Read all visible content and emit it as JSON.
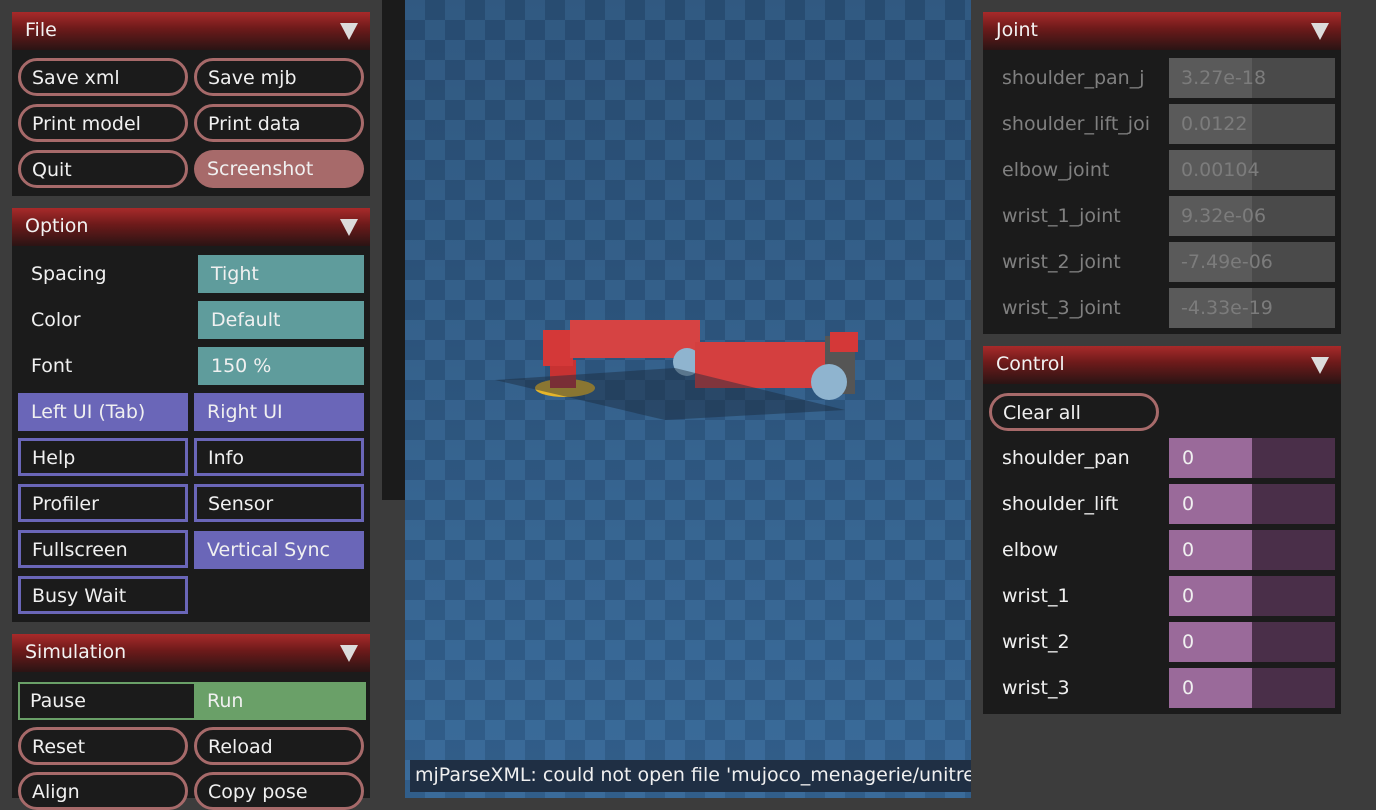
{
  "file": {
    "title": "File",
    "buttons": [
      "Save xml",
      "Save mjb",
      "Print model",
      "Print data",
      "Quit",
      "Screenshot"
    ]
  },
  "option": {
    "title": "Option",
    "rows": [
      {
        "label": "Spacing",
        "value": "Tight"
      },
      {
        "label": "Color",
        "value": "Default"
      },
      {
        "label": "Font",
        "value": "150 %"
      }
    ],
    "buttons": [
      "Left UI (Tab)",
      "Right UI",
      "Help",
      "Info",
      "Profiler",
      "Sensor",
      "Fullscreen",
      "Vertical Sync",
      "Busy Wait"
    ]
  },
  "simulation": {
    "title": "Simulation",
    "mode": [
      "Pause",
      "Run"
    ],
    "buttons": [
      "Reset",
      "Reload",
      "Align",
      "Copy pose"
    ]
  },
  "joint": {
    "title": "Joint",
    "items": [
      {
        "name": "shoulder_pan_j",
        "value": "3.27e-18"
      },
      {
        "name": "shoulder_lift_joi",
        "value": "0.0122"
      },
      {
        "name": "elbow_joint",
        "value": "0.00104"
      },
      {
        "name": "wrist_1_joint",
        "value": "9.32e-06"
      },
      {
        "name": "wrist_2_joint",
        "value": "-7.49e-06"
      },
      {
        "name": "wrist_3_joint",
        "value": "-4.33e-19"
      }
    ]
  },
  "control": {
    "title": "Control",
    "clear_label": "Clear all",
    "items": [
      {
        "name": "shoulder_pan",
        "value": "0"
      },
      {
        "name": "shoulder_lift",
        "value": "0"
      },
      {
        "name": "elbow",
        "value": "0"
      },
      {
        "name": "wrist_1",
        "value": "0"
      },
      {
        "name": "wrist_2",
        "value": "0"
      },
      {
        "name": "wrist_3",
        "value": "0"
      }
    ]
  },
  "status": {
    "message": "mjParseXML: could not open file 'mujoco_menagerie/unitre"
  },
  "colors": {
    "header_red": "#a82a2a",
    "pill_border": "#a76a6a",
    "teal": "#5f9c9c",
    "purple": "#6a66b8",
    "green": "#6aa068",
    "control_fill": "#9a6a9a",
    "floor_blue": "#2b4d72"
  }
}
